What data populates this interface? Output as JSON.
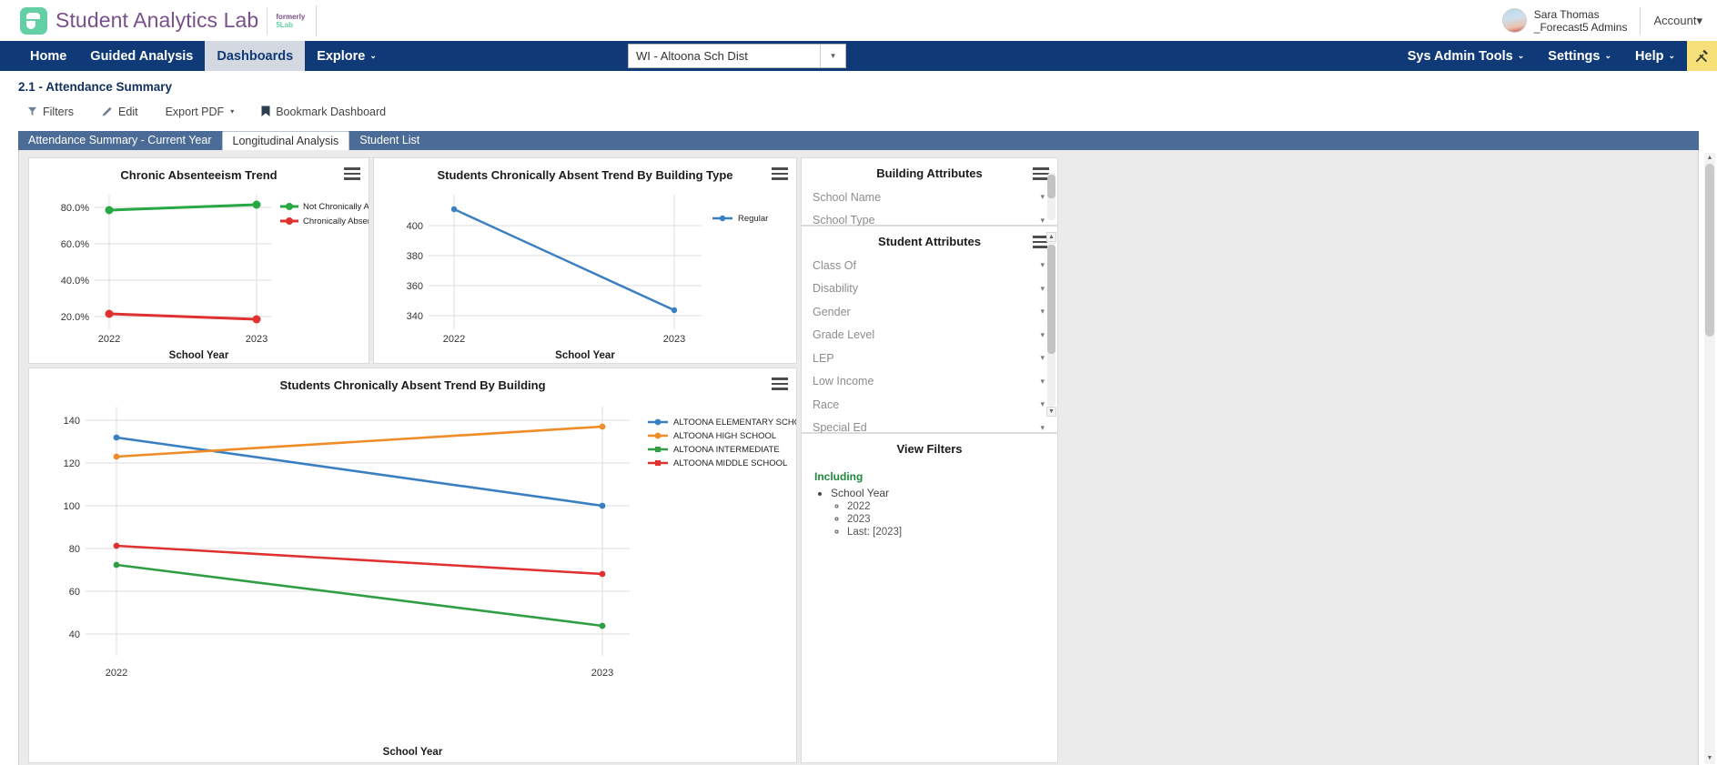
{
  "brand": {
    "name": "Student Analytics Lab",
    "sub_line1": "formerly",
    "sub_line2": "5Lab"
  },
  "user": {
    "name": "Sara Thomas",
    "org": "_Forecast5 Admins",
    "account_label": "Account",
    "account_caret": "▾"
  },
  "nav": {
    "items": [
      {
        "label": "Home",
        "active": false,
        "caret": ""
      },
      {
        "label": "Guided Analysis",
        "active": false,
        "caret": ""
      },
      {
        "label": "Dashboards",
        "active": true,
        "caret": ""
      },
      {
        "label": "Explore",
        "active": false,
        "caret": "⌄"
      }
    ],
    "right_items": [
      {
        "label": "Sys Admin Tools",
        "caret": "⌄"
      },
      {
        "label": "Settings",
        "caret": "⌄"
      },
      {
        "label": "Help",
        "caret": "⌄"
      }
    ],
    "district_value": "WI - Altoona Sch Dist",
    "district_caret": "▾",
    "tools_icon": "wrench-screwdriver-icon"
  },
  "page": {
    "title": "2.1 - Attendance Summary"
  },
  "toolbar": {
    "filters_label": "Filters",
    "edit_label": "Edit",
    "export_label": "Export PDF",
    "export_caret": "▾",
    "bookmark_label": "Bookmark Dashboard"
  },
  "tabs": [
    {
      "label": "Attendance Summary - Current Year",
      "active": false
    },
    {
      "label": "Longitudinal Analysis",
      "active": true
    },
    {
      "label": "Student List",
      "active": false
    }
  ],
  "charts": [
    {
      "title": "Chronic Absenteeism Trend",
      "xlabel": "School Year",
      "menu_icon": "hamburger-menu-icon"
    },
    {
      "title": "Students Chronically Absent Trend By Building Type",
      "xlabel": "School Year",
      "menu_icon": "hamburger-menu-icon"
    },
    {
      "title": "Students Chronically Absent Trend By Building",
      "xlabel": "School Year",
      "menu_icon": "hamburger-menu-icon"
    }
  ],
  "building_attributes": {
    "title": "Building Attributes",
    "menu_icon": "hamburger-menu-icon",
    "items": [
      {
        "label": "School Name",
        "caret": "▾"
      },
      {
        "label": "School Type",
        "caret": "▾"
      }
    ]
  },
  "student_attributes": {
    "title": "Student Attributes",
    "menu_icon": "hamburger-menu-icon",
    "items": [
      {
        "label": "Class Of",
        "caret": "▾"
      },
      {
        "label": "Disability",
        "caret": "▾"
      },
      {
        "label": "Gender",
        "caret": "▾"
      },
      {
        "label": "Grade Level",
        "caret": "▾"
      },
      {
        "label": "LEP",
        "caret": "▾"
      },
      {
        "label": "Low Income",
        "caret": "▾"
      },
      {
        "label": "Race",
        "caret": "▾"
      },
      {
        "label": "Special Ed",
        "caret": "▾"
      }
    ]
  },
  "view_filters": {
    "title": "View Filters",
    "including_label": "Including",
    "group": "School Year",
    "values": [
      "2022",
      "2023",
      "Last: [2023]"
    ]
  },
  "colors": {
    "nav_blue": "#103a77",
    "tab_blue": "#4a6c96",
    "tools_yellow": "#f5e07a",
    "brand_purple": "#7b4f8c",
    "brand_green": "#63cfa5",
    "series_green": "#28a745",
    "series_red": "#e03131",
    "series_blue": "#3a7fc1",
    "series_orange": "#f08c28",
    "including_green": "#1f8a3b"
  },
  "chart_data": [
    {
      "type": "line",
      "title": "Chronic Absenteeism Trend",
      "xlabel": "School Year",
      "ylabel": "",
      "categories": [
        "2022",
        "2023"
      ],
      "ticks": [
        "80.0%",
        "60.0%",
        "40.0%",
        "20.0%"
      ],
      "ylim": [
        10,
        90
      ],
      "grid": true,
      "legend_position": "right",
      "series": [
        {
          "name": "Not Chronically Absent",
          "color": "#28a745",
          "values": [
            78.5,
            81.5
          ]
        },
        {
          "name": "Chronically Absent",
          "color": "#e03131",
          "values": [
            21.5,
            18.5
          ]
        }
      ]
    },
    {
      "type": "line",
      "title": "Students Chronically Absent Trend By Building Type",
      "xlabel": "School Year",
      "ylabel": "",
      "categories": [
        "2022",
        "2023"
      ],
      "ticks": [
        "400",
        "380",
        "360",
        "340"
      ],
      "ylim": [
        333,
        418
      ],
      "grid": true,
      "legend_position": "right",
      "series": [
        {
          "name": "Regular",
          "color": "#3a7fc1",
          "values": [
            411,
            344
          ]
        }
      ]
    },
    {
      "type": "line",
      "title": "Students Chronically Absent Trend By Building",
      "xlabel": "School Year",
      "ylabel": "",
      "categories": [
        "2022",
        "2023"
      ],
      "ticks": [
        "140",
        "120",
        "100",
        "80",
        "60",
        "40"
      ],
      "ylim": [
        30,
        148
      ],
      "grid": true,
      "legend_position": "right",
      "series": [
        {
          "name": "ALTOONA ELEMENTARY SCHOOL",
          "color": "#3a7fc1",
          "values": [
            132,
            100
          ]
        },
        {
          "name": "ALTOONA HIGH SCHOOL",
          "color": "#f08c28",
          "values": [
            123,
            137
          ]
        },
        {
          "name": "ALTOONA INTERMEDIATE",
          "color": "#28a745",
          "values": [
            74,
            44
          ]
        },
        {
          "name": "ALTOONA MIDDLE SCHOOL",
          "color": "#e03131",
          "values": [
            83,
            69
          ]
        }
      ]
    }
  ]
}
